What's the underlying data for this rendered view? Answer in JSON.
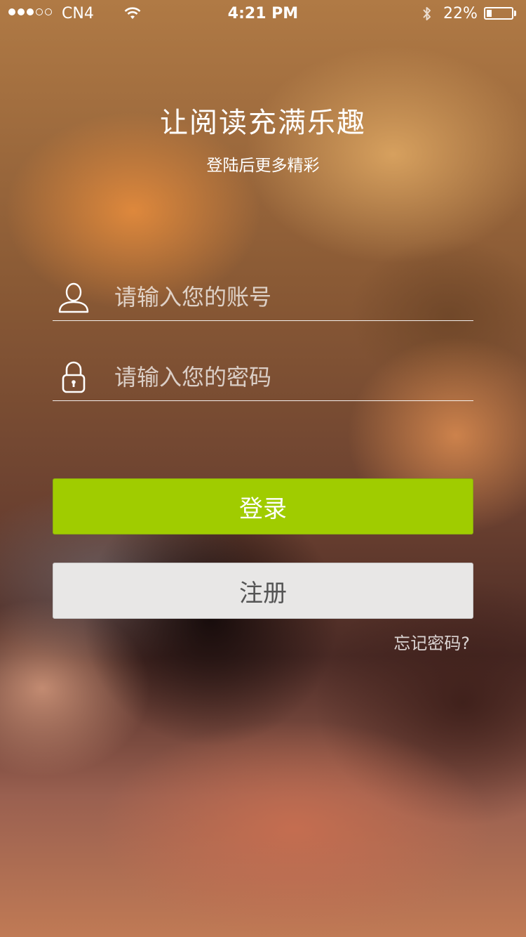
{
  "status_bar": {
    "carrier": "CN4",
    "time": "4:21 PM",
    "battery_percent": "22%",
    "battery_level": 0.22,
    "signal_bars_filled": 3,
    "signal_bars_total": 5,
    "icons": [
      "wifi-icon",
      "bluetooth-icon",
      "battery-icon"
    ]
  },
  "header": {
    "title": "让阅读充满乐趣",
    "subtitle": "登陆后更多精彩"
  },
  "form": {
    "account": {
      "placeholder": "请输入您的账号",
      "value": "",
      "icon": "user-icon"
    },
    "password": {
      "placeholder": "请输入您的密码",
      "value": "",
      "icon": "lock-icon"
    }
  },
  "actions": {
    "login_label": "登录",
    "register_label": "注册",
    "forgot_label": "忘记密码?"
  },
  "colors": {
    "login_button": "#a0cc00",
    "register_button": "#e8e7e6",
    "register_text": "#555555"
  }
}
